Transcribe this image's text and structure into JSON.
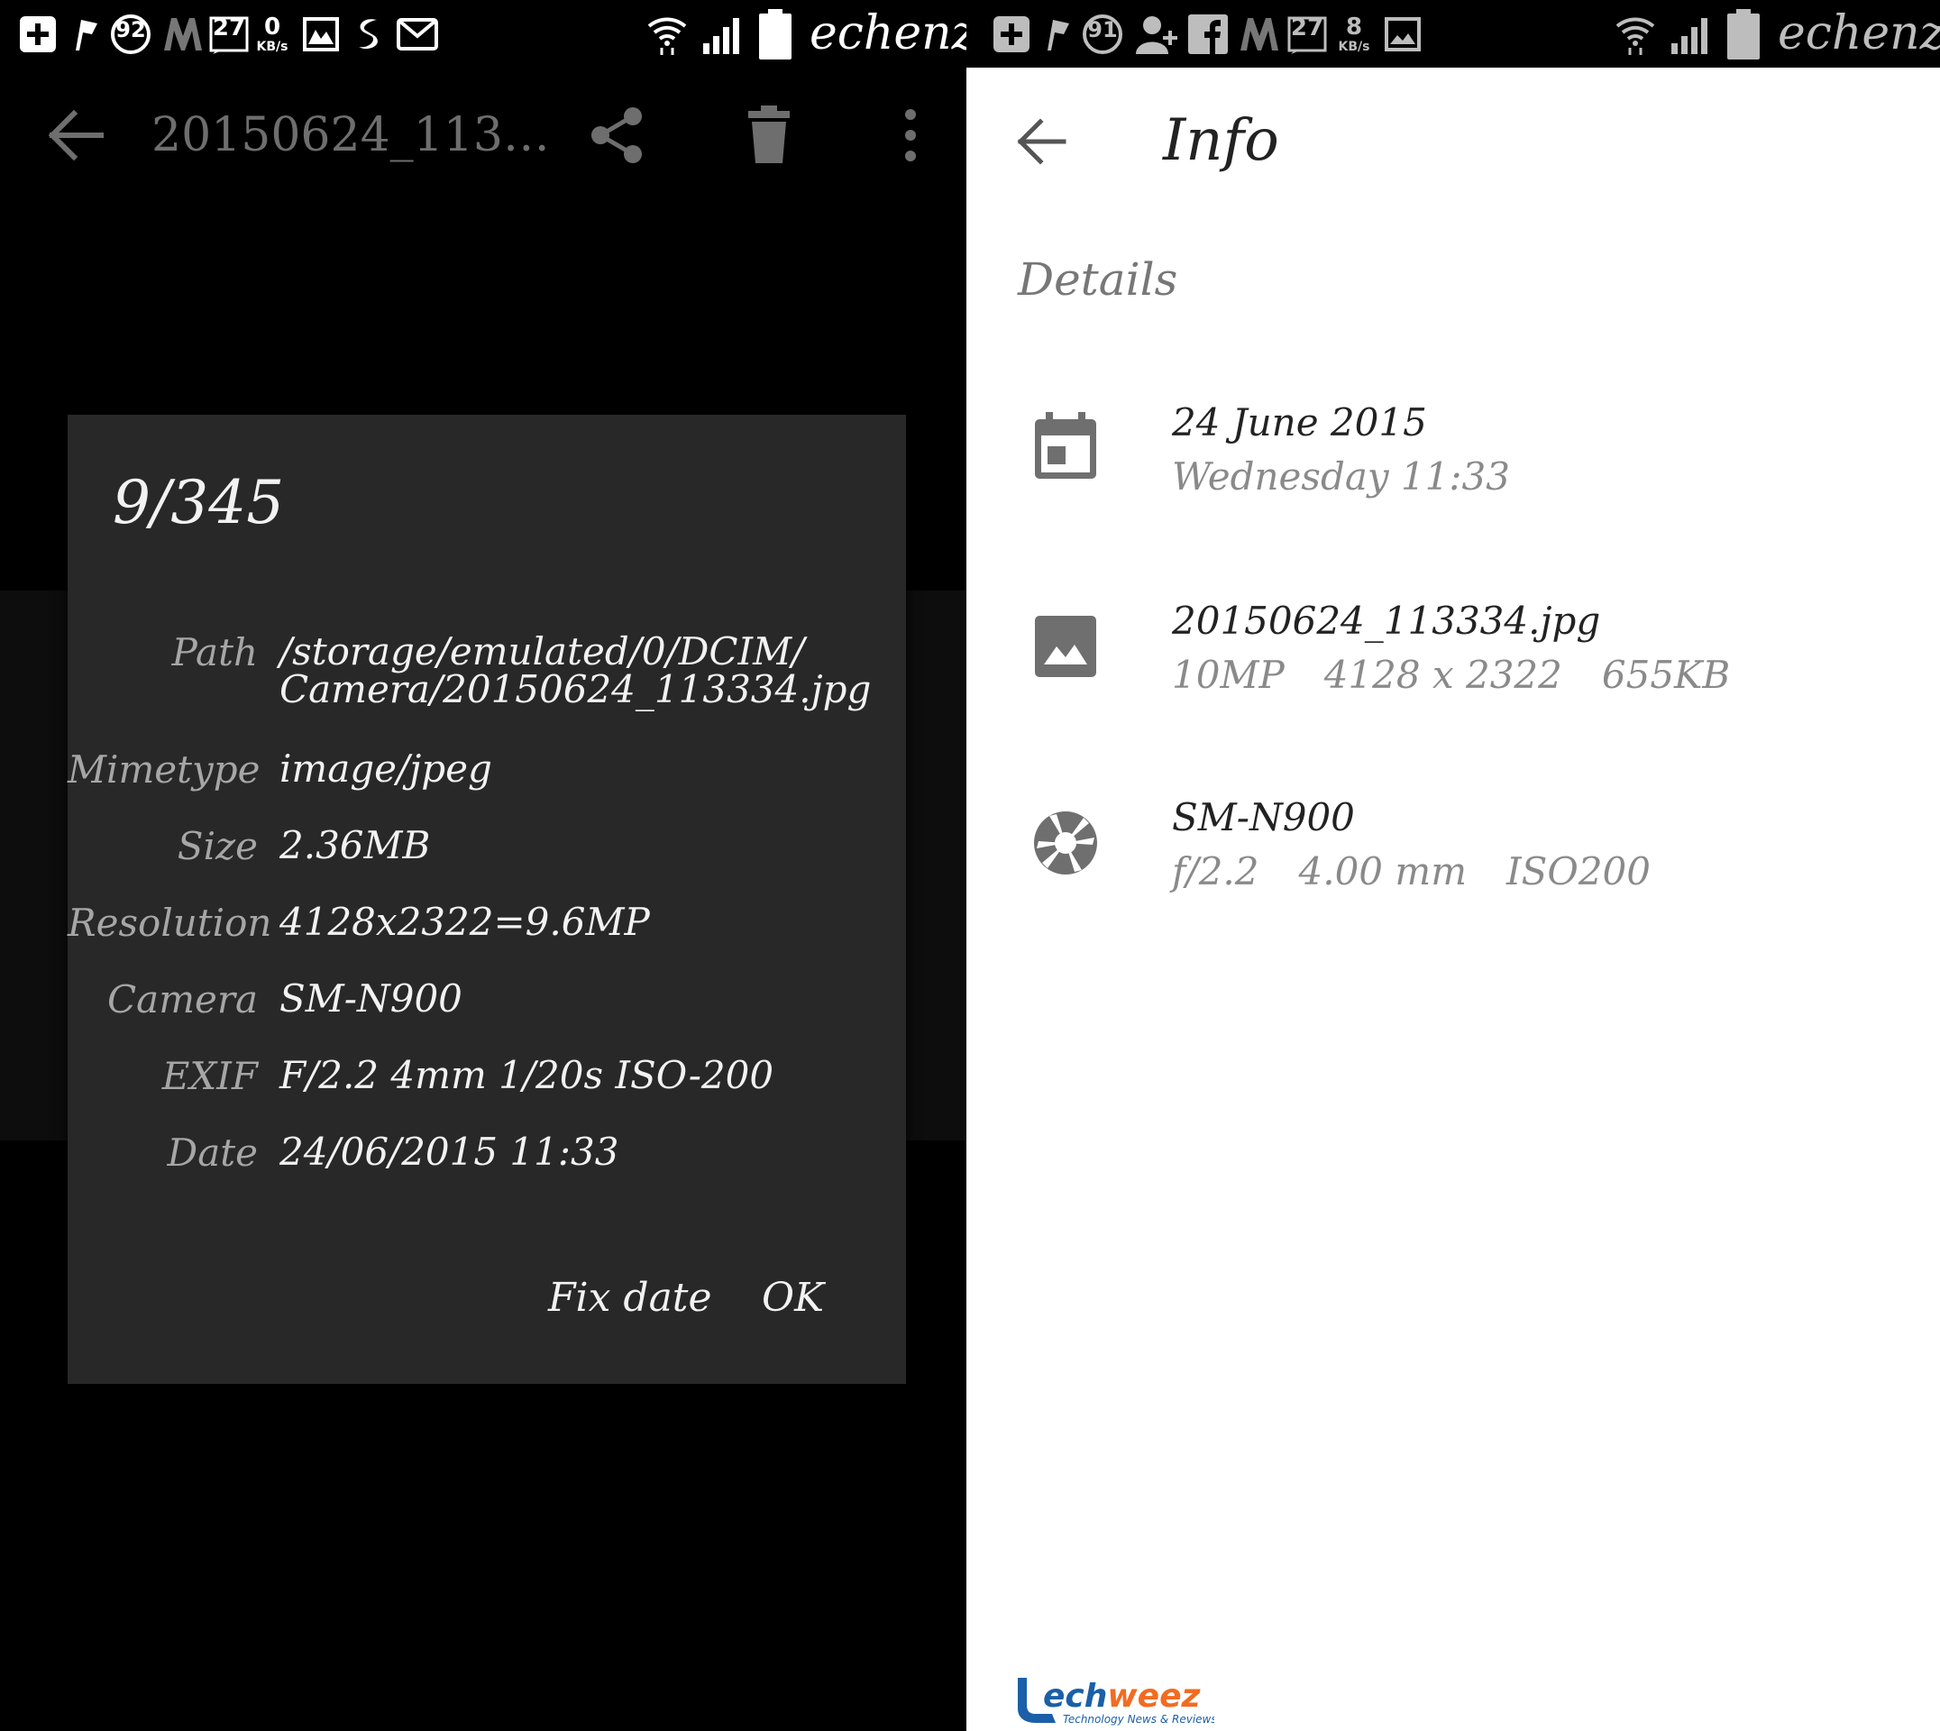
{
  "left": {
    "status": {
      "notification_count": "92",
      "calendar_day": "27",
      "speed_value": "0",
      "speed_unit": "KB/s",
      "carrier": "echenze"
    },
    "appbar": {
      "title": "20150624_113…",
      "back_icon": "back-arrow-icon",
      "share_icon": "share-icon",
      "delete_icon": "trash-icon",
      "more_icon": "overflow-menu-icon"
    },
    "dialog": {
      "counter": "9/345",
      "rows": [
        {
          "label": "Path",
          "value": "/storage/emulated/0/DCIM/ Camera/20150624_113334.jpg"
        },
        {
          "label": "Mimetype",
          "value": "image/jpeg"
        },
        {
          "label": "Size",
          "value": "2.36MB"
        },
        {
          "label": "Resolution",
          "value": "4128x2322=9.6MP"
        },
        {
          "label": "Camera",
          "value": "SM-N900"
        },
        {
          "label": "EXIF",
          "value": "F/2.2 4mm 1/20s ISO-200"
        },
        {
          "label": "Date",
          "value": "24/06/2015 11:33"
        }
      ],
      "fix_date_label": "Fix date",
      "ok_label": "OK"
    }
  },
  "right": {
    "status": {
      "notification_count": "91",
      "calendar_day": "27",
      "speed_value": "8",
      "speed_unit": "KB/s",
      "carrier": "echenze"
    },
    "appbar": {
      "title": "Info",
      "back_icon": "back-arrow-icon"
    },
    "section": "Details",
    "details": [
      {
        "icon": "calendar-icon",
        "primary": "24 June 2015",
        "secondary": [
          "Wednesday 11:33"
        ]
      },
      {
        "icon": "image-icon",
        "primary": "20150624_113334.jpg",
        "secondary": [
          "10MP",
          "4128 x 2322",
          "655KB"
        ]
      },
      {
        "icon": "camera-aperture-icon",
        "primary": "SM-N900",
        "secondary": [
          "f/2.2",
          "4.00 mm",
          "ISO200"
        ]
      }
    ]
  },
  "watermark": {
    "brand": "techweez",
    "tagline": "Technology News & Reviews"
  },
  "colors": {
    "dialog_bg": "#282828",
    "dark_bg": "#000000",
    "light_bg": "#ffffff",
    "watermark_blue": "#1b5fa8",
    "watermark_orange": "#f26b21"
  }
}
